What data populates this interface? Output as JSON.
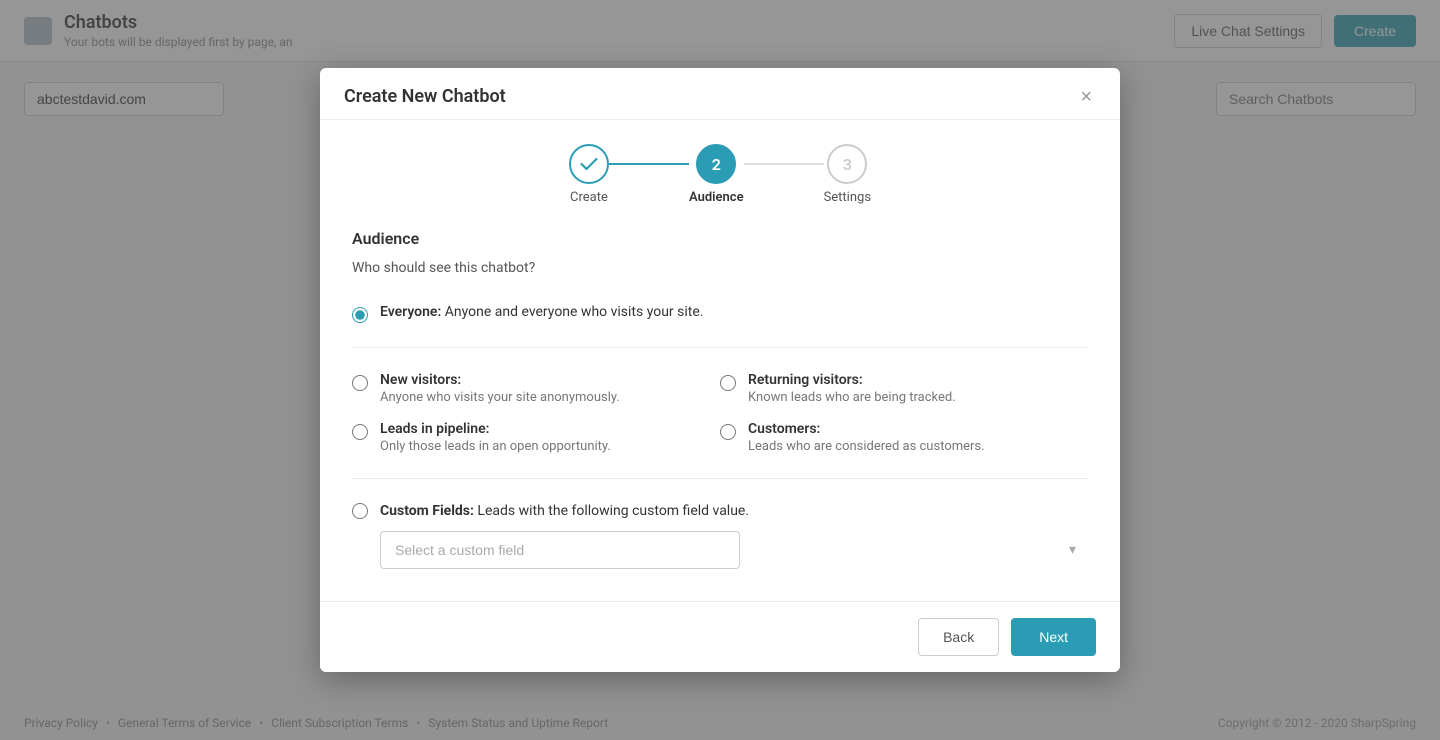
{
  "page": {
    "title": "Chatbots",
    "subtitle": "Your bots will be displayed first by page, an",
    "domain": "abctestdavid.com",
    "search_placeholder": "Search Chatbots",
    "btn_live_chat": "Live Chat Settings",
    "btn_create": "Create"
  },
  "modal": {
    "title": "Create New Chatbot",
    "close_label": "×",
    "steps": [
      {
        "label": "Create",
        "state": "completed",
        "number": "1"
      },
      {
        "label": "Audience",
        "state": "active",
        "number": "2"
      },
      {
        "label": "Settings",
        "state": "inactive",
        "number": "3"
      }
    ],
    "section_title": "Audience",
    "question": "Who should see this chatbot?",
    "options": [
      {
        "id": "everyone",
        "label_bold": "Everyone:",
        "label_rest": " Anyone and everyone who visits your site.",
        "description": "",
        "checked": true,
        "col": "full"
      },
      {
        "id": "new_visitors",
        "label_bold": "New visitors:",
        "label_rest": "",
        "description": "Anyone who visits your site anonymously.",
        "checked": false,
        "col": "left"
      },
      {
        "id": "returning_visitors",
        "label_bold": "Returning visitors:",
        "label_rest": "",
        "description": "Known leads who are being tracked.",
        "checked": false,
        "col": "right"
      },
      {
        "id": "leads_pipeline",
        "label_bold": "Leads in pipeline:",
        "label_rest": "",
        "description": "Only those leads in an open opportunity.",
        "checked": false,
        "col": "left"
      },
      {
        "id": "customers",
        "label_bold": "Customers:",
        "label_rest": "",
        "description": "Leads who are considered as customers.",
        "checked": false,
        "col": "right"
      }
    ],
    "custom_fields": {
      "id": "custom_fields",
      "label_bold": "Custom Fields:",
      "label_rest": " Leads with the following custom field value.",
      "checked": false,
      "select_placeholder": "Select a custom field"
    },
    "btn_back": "Back",
    "btn_next": "Next"
  },
  "footer": {
    "links": [
      "Privacy Policy",
      "•",
      "General Terms of Service",
      "•",
      "Client Subscription Terms",
      "•",
      "System Status and Uptime Report"
    ],
    "copyright": "Copyright © 2012 - 2020 SharpSpring"
  }
}
